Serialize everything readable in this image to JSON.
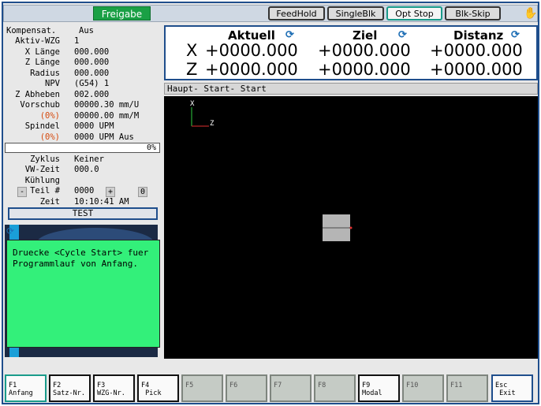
{
  "topbar": {
    "freigabe": "Freigabe",
    "buttons": [
      {
        "label": "FeedHold",
        "active": false
      },
      {
        "label": "SingleBlk",
        "active": false
      },
      {
        "label": "Opt Stop",
        "active": true
      },
      {
        "label": "Blk-Skip",
        "active": false
      }
    ],
    "hand_icon": "hand-icon"
  },
  "left": {
    "kompensat_label": "Kompensat.",
    "kompensat_value": "Aus",
    "aktiv_wzg_label": "Aktiv-WZG",
    "aktiv_wzg_value": "1",
    "x_laenge_label": "X Länge",
    "x_laenge_value": "000.000",
    "z_laenge_label": "Z Länge",
    "z_laenge_value": "000.000",
    "radius_label": "Radius",
    "radius_value": "000.000",
    "npv_label": "NPV",
    "npv_value": "(G54) 1",
    "z_abheben_label": "Z Abheben",
    "z_abheben_value": "002.000",
    "vorschub_label": "Vorschub",
    "vorschub_value": "00000.30 mm/U",
    "vorschub_pct_label": "(0%)",
    "vorschub_pct_value": "00000.00 mm/M",
    "spindel_label": "Spindel",
    "spindel_value": "0000 UPM",
    "spindel_pct_label": "(0%)",
    "spindel_pct_value": "0000 UPM Aus",
    "progress_text": "0%",
    "zyklus_label": "Zyklus",
    "zyklus_value": "Keiner",
    "vw_zeit_label": "VW-Zeit",
    "vw_zeit_value": "000.0",
    "kuehlung_label": "Kühlung",
    "teil_minus": "-",
    "teil_label": "Teil #",
    "teil_value": "0000",
    "teil_plus": "+",
    "teil_count": "0",
    "zeit_label": "Zeit",
    "zeit_value": "10:10:41 AM",
    "test_button": "TEST"
  },
  "message": "Druecke <Cycle Start> fuer\nProgrammlauf von Anfang.",
  "dro": {
    "headers": [
      "Aktuell",
      "Ziel",
      "Distanz"
    ],
    "axes": [
      {
        "name": "X",
        "aktuell": "+0000.000",
        "ziel": "+0000.000",
        "distanz": "+0000.000"
      },
      {
        "name": "Z",
        "aktuell": "+0000.000",
        "ziel": "+0000.000",
        "distanz": "+0000.000"
      }
    ]
  },
  "status_line": "Haupt-  Start-  Start",
  "viewport": {
    "axis_x_label": "X",
    "axis_z_label": "Z"
  },
  "fkeys": [
    {
      "label": "F1\nAnfang",
      "enabled": true
    },
    {
      "label": "F2\nSatz-Nr.",
      "enabled": true
    },
    {
      "label": "F3\nWZG-Nr.",
      "enabled": true
    },
    {
      "label": "F4\n Pick",
      "enabled": true
    },
    {
      "label": "F5",
      "enabled": false
    },
    {
      "label": "F6",
      "enabled": false
    },
    {
      "label": "F7",
      "enabled": false
    },
    {
      "label": "F8",
      "enabled": false
    },
    {
      "label": "F9\nModal",
      "enabled": true
    },
    {
      "label": "F10",
      "enabled": false
    },
    {
      "label": "F11",
      "enabled": false
    },
    {
      "label": "Esc\n Exit",
      "enabled": true
    }
  ],
  "colors": {
    "accent": "#1f4e8c",
    "ok": "#1aa045",
    "message_bg": "#33f07a",
    "warn": "#d54a0e"
  }
}
